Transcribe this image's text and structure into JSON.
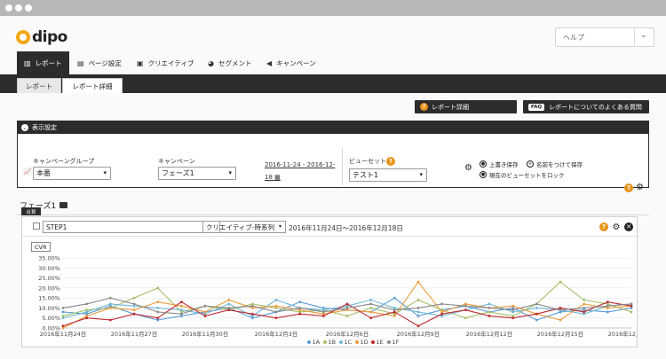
{
  "app": {
    "logo_text": "dipo",
    "help_select": "ヘルプ"
  },
  "main_nav": [
    {
      "label": "レポート",
      "icon": "bar-chart-icon",
      "active": true
    },
    {
      "label": "ページ設定",
      "icon": "layout-icon",
      "active": false
    },
    {
      "label": "クリエイティブ",
      "icon": "image-icon",
      "active": false
    },
    {
      "label": "セグメント",
      "icon": "pie-chart-icon",
      "active": false
    },
    {
      "label": "キャンペーン",
      "icon": "megaphone-icon",
      "active": false
    }
  ],
  "sub_tabs": [
    {
      "label": "レポート",
      "active": false
    },
    {
      "label": "レポート詳細",
      "active": true
    }
  ],
  "actions": {
    "report_detail": "レポート詳細",
    "faq_badge": "FAQ",
    "faq_label": "レポートについてのよくある質問"
  },
  "display_settings": {
    "title": "表示設定",
    "campaign_group_label": "キャンペーングループ",
    "campaign_group_value": "本番",
    "campaign_label": "キャンペーン",
    "campaign_value": "フェーズ1",
    "date_line1": "2016-11-24 - 2016-12-",
    "date_line2": "18",
    "view_preset_label": "ビューセット",
    "view_preset_value": "テスト1",
    "overwrite_save": "上書き保存",
    "save_as": "名前をつけて保存",
    "lock_view": "現在のビューセットをロック"
  },
  "section": {
    "title": "フェーズ1",
    "tab_label": "合算"
  },
  "step": {
    "name": "STEP1",
    "view_mode": "クリエイティブ-時系列",
    "date_range": "2016年11月24日〜2016年12月18日",
    "metric": "CVR"
  },
  "colors": {
    "accent": "#e8931a",
    "dark": "#2c2c2c"
  },
  "chart_data": {
    "type": "line",
    "ylim": [
      0,
      35
    ],
    "y_ticks": [
      "0.00%",
      "5.00%",
      "10.00%",
      "15.00%",
      "20.00%",
      "25.00%",
      "30.00%",
      "35.00%"
    ],
    "x_tick_labels": [
      "2016年11月24日",
      "2016年11月27日",
      "2016年11月30日",
      "2016年12月3日",
      "2016年12月6日",
      "2016年12月9日",
      "2016年12月12日",
      "2016年12月15日",
      "2016年12月18日"
    ],
    "x_count": 25,
    "legend_position": "bottom",
    "series": [
      {
        "name": "1A",
        "color": "#5b9bd5",
        "values": [
          8,
          7,
          11,
          7,
          4,
          6,
          8,
          10,
          5,
          8,
          13,
          10,
          9,
          8,
          15,
          6,
          9,
          11,
          8,
          10,
          4,
          8,
          9,
          8,
          10
        ]
      },
      {
        "name": "1B",
        "color": "#a5c06a",
        "values": [
          6,
          9,
          10,
          15,
          20,
          8,
          11,
          9,
          12,
          10,
          8,
          9,
          6,
          10,
          7,
          14,
          9,
          5,
          8,
          6,
          12,
          23,
          14,
          12,
          8
        ]
      },
      {
        "name": "1C",
        "color": "#70b8d8",
        "values": [
          5,
          8,
          12,
          11,
          10,
          9,
          7,
          12,
          6,
          14,
          10,
          9,
          11,
          14,
          10,
          8,
          6,
          9,
          12,
          8,
          10,
          9,
          7,
          11,
          12
        ]
      },
      {
        "name": "1D",
        "color": "#ed9b3b",
        "values": [
          0,
          6,
          10,
          9,
          13,
          11,
          8,
          14,
          10,
          11,
          9,
          7,
          9,
          8,
          6,
          23,
          8,
          12,
          10,
          11,
          7,
          4,
          12,
          10,
          11
        ]
      },
      {
        "name": "1E",
        "color": "#c0282f",
        "values": [
          1,
          5,
          4,
          7,
          5,
          13,
          6,
          9,
          7,
          5,
          7,
          6,
          12,
          5,
          8,
          1,
          7,
          9,
          6,
          5,
          7,
          10,
          8,
          13,
          11
        ]
      },
      {
        "name": "1F",
        "color": "#8a8a8a",
        "values": [
          10,
          12,
          15,
          12,
          8,
          7,
          11,
          10,
          11,
          8,
          10,
          8,
          10,
          12,
          9,
          10,
          12,
          11,
          10,
          9,
          12,
          9,
          10,
          11,
          12
        ]
      }
    ]
  }
}
